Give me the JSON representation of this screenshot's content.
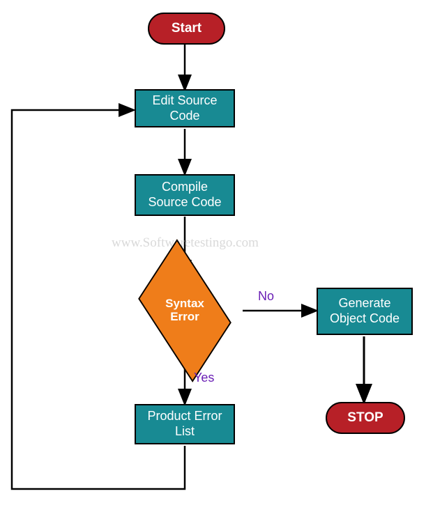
{
  "chart_data": {
    "type": "flowchart",
    "title": "",
    "nodes": [
      {
        "id": "start",
        "type": "terminator",
        "label": "Start"
      },
      {
        "id": "edit",
        "type": "process",
        "label": "Edit Source Code"
      },
      {
        "id": "compile",
        "type": "process",
        "label": "Compile Source Code"
      },
      {
        "id": "syntax",
        "type": "decision",
        "label": "Syntax Error"
      },
      {
        "id": "productlist",
        "type": "process",
        "label": "Product Error List"
      },
      {
        "id": "generate",
        "type": "process",
        "label": "Generate Object Code"
      },
      {
        "id": "stop",
        "type": "terminator",
        "label": "STOP"
      }
    ],
    "edges": [
      {
        "from": "start",
        "to": "edit",
        "label": ""
      },
      {
        "from": "edit",
        "to": "compile",
        "label": ""
      },
      {
        "from": "compile",
        "to": "syntax",
        "label": ""
      },
      {
        "from": "syntax",
        "to": "generate",
        "label": "No"
      },
      {
        "from": "syntax",
        "to": "productlist",
        "label": "Yes"
      },
      {
        "from": "generate",
        "to": "stop",
        "label": ""
      },
      {
        "from": "productlist",
        "to": "edit",
        "label": ""
      }
    ]
  },
  "nodes": {
    "start": "Start",
    "edit_l1": "Edit Source",
    "edit_l2": "Code",
    "compile_l1": "Compile",
    "compile_l2": "Source Code",
    "syntax_l1": "Syntax",
    "syntax_l2": "Error",
    "product_l1": "Product Error",
    "product_l2": "List",
    "generate_l1": "Generate",
    "generate_l2": "Object Code",
    "stop": "STOP"
  },
  "labels": {
    "no": "No",
    "yes": "Yes"
  },
  "watermark": "www.Softwaretestingo.com"
}
